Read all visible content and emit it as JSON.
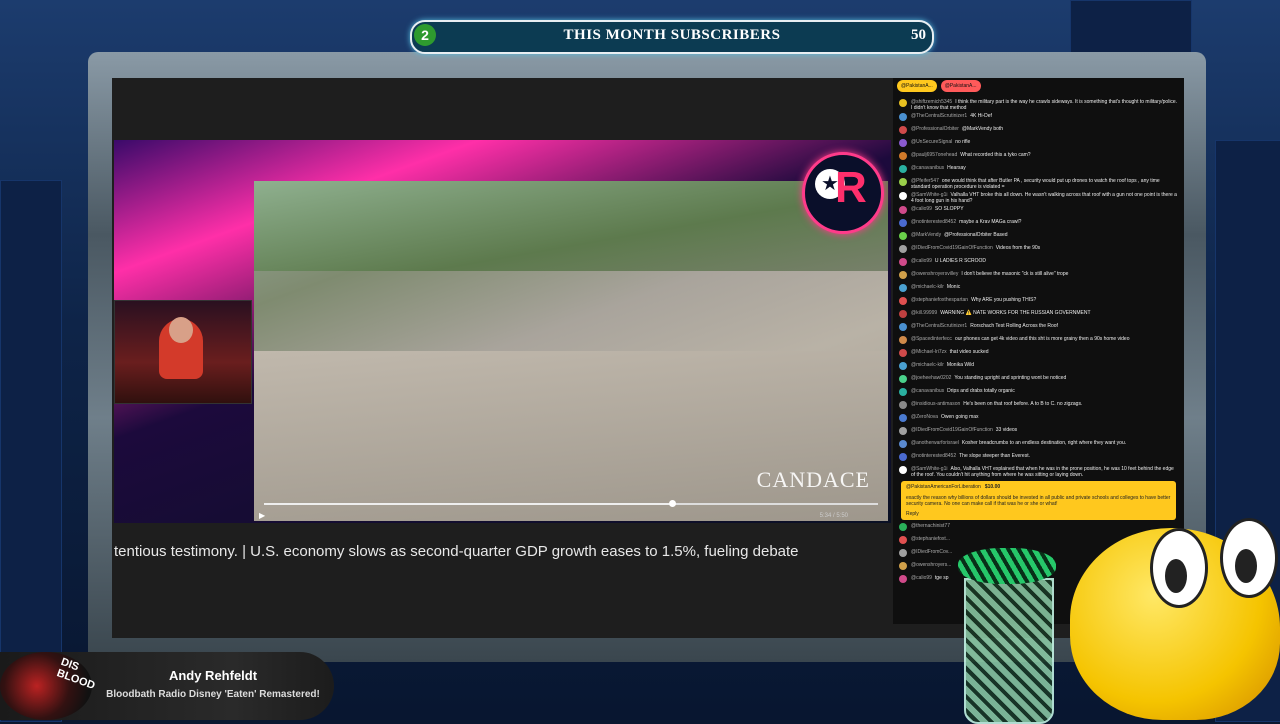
{
  "subscribers_bar": {
    "left_count": "2",
    "title": "THIS MONTH SUBSCRIBERS",
    "right_count": "50"
  },
  "video": {
    "watermark": "CANDACE",
    "time": "5:34 / 5:50",
    "play_icon": "play-icon"
  },
  "ticker": {
    "text": "tentious testimony. | U.S. economy slows as second-quarter GDP growth eases to 1.5%, fueling debate"
  },
  "chat": {
    "pinned": [
      "@PakistanA...",
      "@PakistanA..."
    ],
    "messages": [
      {
        "user": "@shiftzemich5345",
        "text": "I think the military part is the way he crawls sideways. It is something that's thought to military/police. I didn't know that method",
        "color": "#e8c020"
      },
      {
        "user": "@TheCentralScrutinizer1",
        "text": "4K Hi-Def",
        "color": "#4a90d0"
      },
      {
        "user": "@ProfessionalOrbiter",
        "text": "@MarkVendy both",
        "color": "#d04a4a"
      },
      {
        "user": "@UnSecureSignal",
        "text": "no rifle",
        "color": "#8a5ad0"
      },
      {
        "user": "@paulj6957onehead",
        "text": "What recorded this a tyko cam?",
        "color": "#d07a2a"
      },
      {
        "user": "@canavanibus",
        "text": "Hearsay",
        "color": "#2ab0a0"
      },
      {
        "user": "@Pfeifer547",
        "text": "one would think that after Butler PA , security would put up drones to watch the roof tops , any time standard operation procedure is violated =",
        "color": "#9ad04a"
      },
      {
        "user": "@SamWhite-g1i",
        "text": "Valhalla VHT broke this all down. He wasn't walking across that roof with a gun not one point is there a 4 foot long gun in his hand?",
        "color": "#ffffff"
      },
      {
        "user": "@calio99",
        "text": "SO SLOPPY",
        "color": "#d04a8a"
      },
      {
        "user": "@notinterested8452",
        "text": "maybe a Krav MAGa crawl?",
        "color": "#4a6ad0"
      },
      {
        "user": "@MarkVendy",
        "text": "@ProfessionalOrbiter Based",
        "color": "#6ad04a"
      },
      {
        "user": "@IDiedFromCovid19GainOfFunction",
        "text": "Videos from the 90s",
        "color": "#a0a0a0"
      },
      {
        "user": "@calio99",
        "text": "U LADIES R SCROOD",
        "color": "#d04a8a"
      },
      {
        "user": "@owenshroyersvilley",
        "text": "I don't believe the masonic \"ck is still alive\" trope",
        "color": "#d0a04a"
      },
      {
        "user": "@michaelc-kilr",
        "text": "Monic",
        "color": "#4aa0d0"
      },
      {
        "user": "@stephaniefoxthespartan",
        "text": "Why ARE you pushing THIS?",
        "color": "#e05050"
      },
      {
        "user": "@kill.99999",
        "text": "WARNING ⚠️ NATE WORKS FOR THE RUSSIAN GOVERNMENT",
        "color": "#c04040"
      },
      {
        "user": "@TheCentralScrutinizer1",
        "text": "Rorschach Test Rolling Across the Roof",
        "color": "#4a90d0"
      },
      {
        "user": "@Spacedinterfecc",
        "text": "our phones can get 4k video and this sht is more grainy then a 90s home video",
        "color": "#d08a4a"
      },
      {
        "user": "@Michael-lri7zx",
        "text": "that video sucked",
        "color": "#d04a4a"
      },
      {
        "user": "@michaelc-kilr",
        "text": "Monika Wild",
        "color": "#4aa0d0"
      },
      {
        "user": "@joeheehaw0202",
        "text": "You standing upright and sprinting wont be noticed",
        "color": "#4ad08a"
      },
      {
        "user": "@canavanibus",
        "text": "Drips and drabs totally organic",
        "color": "#2ab0a0"
      },
      {
        "user": "@insidious-antimason",
        "text": "He's been on that roof before. A to B to C. no zigzags.",
        "color": "#8a8a8a"
      },
      {
        "user": "@ZeroNova",
        "text": "Owen going max",
        "color": "#4a7ad0"
      },
      {
        "user": "@IDiedFromCovid19GainOfFunction",
        "text": "33 videos",
        "color": "#a0a0a0"
      },
      {
        "user": "@anotherwarforisrael",
        "text": "Kosher breadcrumbs to an endless destination, right where they want you.",
        "color": "#5a8ad0"
      },
      {
        "user": "@notinterested8452",
        "text": "The slope steeper than Everest.",
        "color": "#4a6ad0"
      },
      {
        "user": "@SamWhite-g1i",
        "text": "Also, Valhalla VHT explained that when he was in the prone position, he was 10 feet behind the edge of the roof. You couldn't hit anything from where he was sitting or laying down.",
        "color": "#ffffff"
      }
    ],
    "superchat": {
      "user": "@PakistanAmericanForLiberation",
      "amount": "$10.00",
      "text": "exactly the reason why billions of dollars should be invested in all public and private schools and colleges to have better security camera. No one can make call if that was he or she or what!",
      "reply": "Reply"
    },
    "after_messages": [
      {
        "user": "@thernachinist77",
        "text": "",
        "color": "#2ab05a"
      },
      {
        "user": "@stephaniefoxt...",
        "text": "",
        "color": "#e05050"
      },
      {
        "user": "@IDiedFromCov...",
        "text": "",
        "color": "#a0a0a0"
      },
      {
        "user": "@owenshroyers...",
        "text": "",
        "color": "#d0a04a"
      },
      {
        "user": "@calio99",
        "text": "tge sp",
        "color": "#d04a8a"
      }
    ]
  },
  "now_playing": {
    "artist": "Andy Rehfeldt",
    "song": "Bloodbath Radio Disney 'Eaten' Remastered!",
    "art_text": "DIS BLOOD"
  }
}
